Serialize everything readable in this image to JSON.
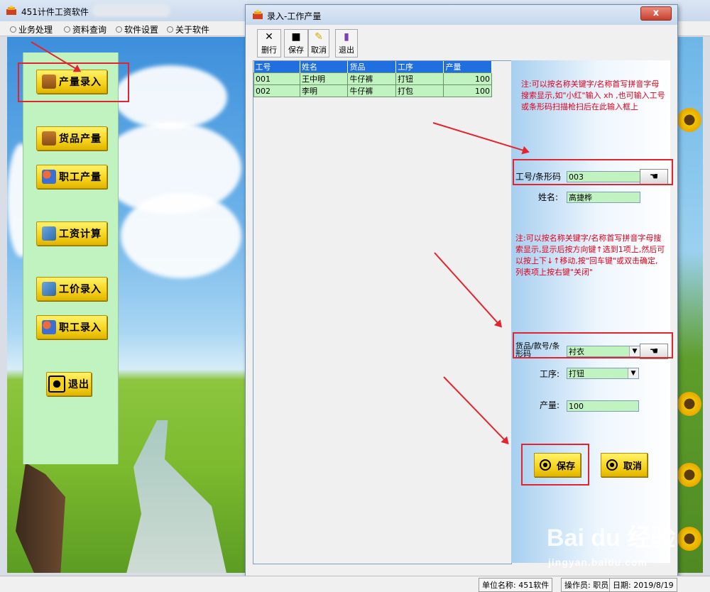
{
  "app": {
    "title": "451计件工资软件"
  },
  "menu": [
    "业务处理",
    "资料查询",
    "软件设置",
    "关于软件"
  ],
  "nav": [
    {
      "label": "产量录入",
      "icon": "gift-icon"
    },
    {
      "label": "货品产量",
      "icon": "gift-icon"
    },
    {
      "label": "职工产量",
      "icon": "users-icon"
    },
    {
      "label": "工资计算",
      "icon": "tools-icon"
    },
    {
      "label": "工价录入",
      "icon": "tools-icon"
    },
    {
      "label": "职工录入",
      "icon": "users-icon"
    },
    {
      "label": "退出",
      "icon": "radio-icon"
    }
  ],
  "dialog": {
    "title": "录入-工作产量",
    "close": "x",
    "toolbar": [
      {
        "label": "删行",
        "icon": "delete-x-icon"
      },
      {
        "label": "保存",
        "icon": "floppy-disk-icon"
      },
      {
        "label": "取消",
        "icon": "cancel-pen-icon"
      },
      {
        "label": "退出",
        "icon": "exit-book-icon"
      }
    ],
    "grid": {
      "columns": [
        "工号",
        "姓名",
        "货品",
        "工序",
        "产量"
      ],
      "rows": [
        [
          "001",
          "王中明",
          "牛仔裤",
          "打钮",
          "100"
        ],
        [
          "002",
          "李明",
          "牛仔裤",
          "打包",
          "100"
        ]
      ]
    },
    "form": {
      "note1": "注:可以按名称关键字/名称首写拼音字母搜索显示,如\"小红\"输入 xh ,也可输入工号或条形码扫描枪扫后在此输入框上",
      "note2": "注:可以按名称关键字/名称首写拼音字母搜索显示,显示后按方向键↑选到1项上,然后可以按上下↓↑移动,按\"回车键\"或双击确定, 列表项上按右键\"关闭\"",
      "worker_label": "工号/条形码",
      "worker_value": "003",
      "name_label": "姓名:",
      "name_value": "高捷桦",
      "product_label": "货品/款号/条形码",
      "product_value": "衬衣",
      "process_label": "工序:",
      "process_value": "打钮",
      "qty_label": "产量:",
      "qty_value": "100",
      "save": "保存",
      "cancel": "取消"
    }
  },
  "status": [
    "单位名称: 451软件",
    "操作员: 职员",
    "日期: 2019/8/19"
  ],
  "watermark": {
    "logo": "Bai du 经验",
    "url": "jingyan.baidu.com"
  },
  "colors": {
    "field_bg": "#c1f3c1",
    "header_blue": "#1f6fe0",
    "annotation_red": "#e2242f",
    "button_yellow": "#f6d21a"
  }
}
